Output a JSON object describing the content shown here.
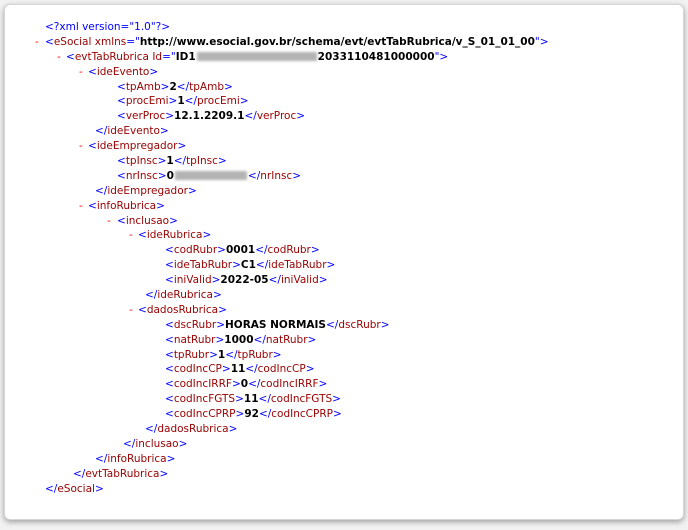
{
  "xml": {
    "declaration": "<?xml version=\"1.0\"?>",
    "toggle_symbol": "-",
    "root": {
      "tag": "eSocial",
      "attr_name": "xmlns",
      "attr_value": "http://www.esocial.gov.br/schema/evt/evtTabRubrica/v_S_01_01_00"
    },
    "evt": {
      "tag": "evtTabRubrica",
      "attr_name": "Id",
      "id_prefix": "ID1",
      "id_suffix": "2033110481000000"
    },
    "ideEvento": {
      "tag": "ideEvento",
      "tpAmb": {
        "tag": "tpAmb",
        "value": "2"
      },
      "procEmi": {
        "tag": "procEmi",
        "value": "1"
      },
      "verProc": {
        "tag": "verProc",
        "value": "12.1.2209.1"
      }
    },
    "ideEmpregador": {
      "tag": "ideEmpregador",
      "tpInsc": {
        "tag": "tpInsc",
        "value": "1"
      },
      "nrInsc": {
        "tag": "nrInsc",
        "value_prefix": "0"
      }
    },
    "infoRubrica": {
      "tag": "infoRubrica",
      "inclusao": "inclusao",
      "ideRubrica": {
        "tag": "ideRubrica",
        "codRubr": {
          "tag": "codRubr",
          "value": "0001"
        },
        "ideTabRubr": {
          "tag": "ideTabRubr",
          "value": "C1"
        },
        "iniValid": {
          "tag": "iniValid",
          "value": "2022-05"
        }
      },
      "dadosRubrica": {
        "tag": "dadosRubrica",
        "dscRubr": {
          "tag": "dscRubr",
          "value": "HORAS NORMAIS"
        },
        "natRubr": {
          "tag": "natRubr",
          "value": "1000"
        },
        "tpRubr": {
          "tag": "tpRubr",
          "value": "1"
        },
        "codIncCP": {
          "tag": "codIncCP",
          "value": "11"
        },
        "codIncIRRF": {
          "tag": "codIncIRRF",
          "value": "0"
        },
        "codIncFGTS": {
          "tag": "codIncFGTS",
          "value": "11"
        },
        "codIncCPRP": {
          "tag": "codIncCPRP",
          "value": "92"
        }
      }
    }
  }
}
